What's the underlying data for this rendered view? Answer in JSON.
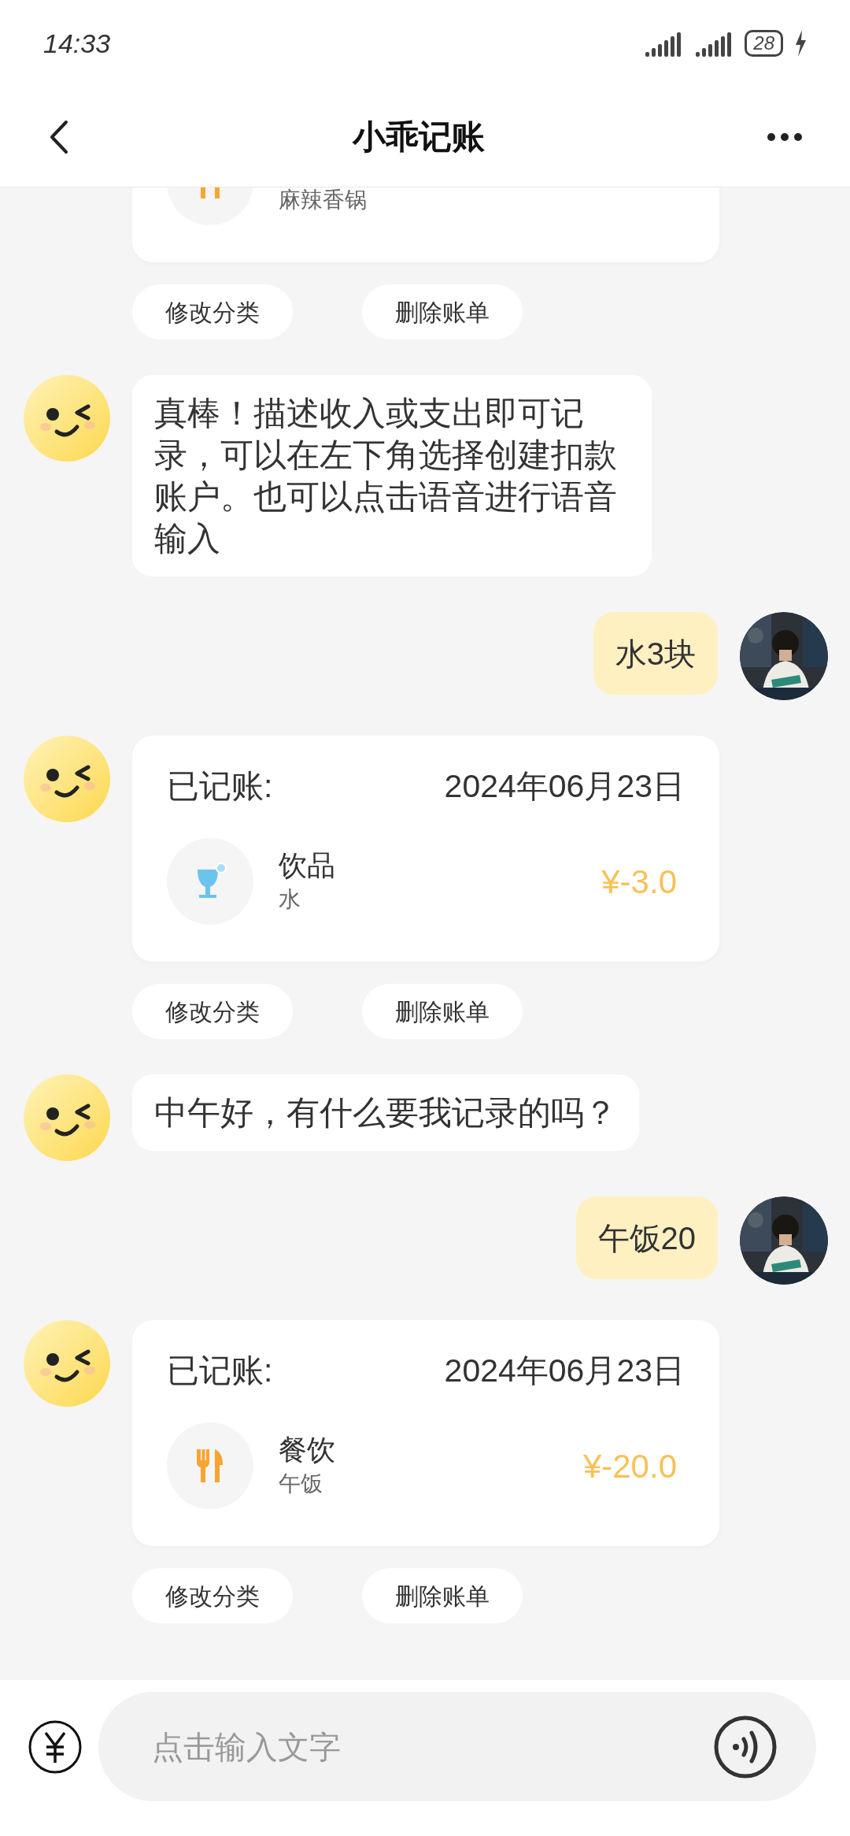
{
  "status_bar": {
    "time": "14:33",
    "battery": "28"
  },
  "header": {
    "title": "小乖记账"
  },
  "messages": [
    {
      "kind": "record_tail",
      "entry": {
        "kind": "dining",
        "note": "麻辣香锅"
      },
      "actions": [
        "修改分类",
        "删除账单"
      ]
    },
    {
      "kind": "bot_text",
      "text": "真棒！描述收入或支出即可记录，可以在左下角选择创建扣款账户。也可以点击语音进行语音输入"
    },
    {
      "kind": "user_text",
      "text": "水3块"
    },
    {
      "kind": "record",
      "label": "已记账:",
      "date": "2024年06月23日",
      "entry": {
        "kind": "drinks",
        "category": "饮品",
        "note": "水",
        "amount": "¥-3.0"
      },
      "actions": [
        "修改分类",
        "删除账单"
      ]
    },
    {
      "kind": "bot_text",
      "text": "中午好，有什么要我记录的吗？"
    },
    {
      "kind": "user_text",
      "text": "午饭20"
    },
    {
      "kind": "record",
      "label": "已记账:",
      "date": "2024年06月23日",
      "entry": {
        "kind": "dining",
        "category": "餐饮",
        "note": "午饭",
        "amount": "¥-20.0"
      },
      "actions": [
        "修改分类",
        "删除账单"
      ]
    }
  ],
  "composer": {
    "placeholder": "点击输入文字"
  }
}
